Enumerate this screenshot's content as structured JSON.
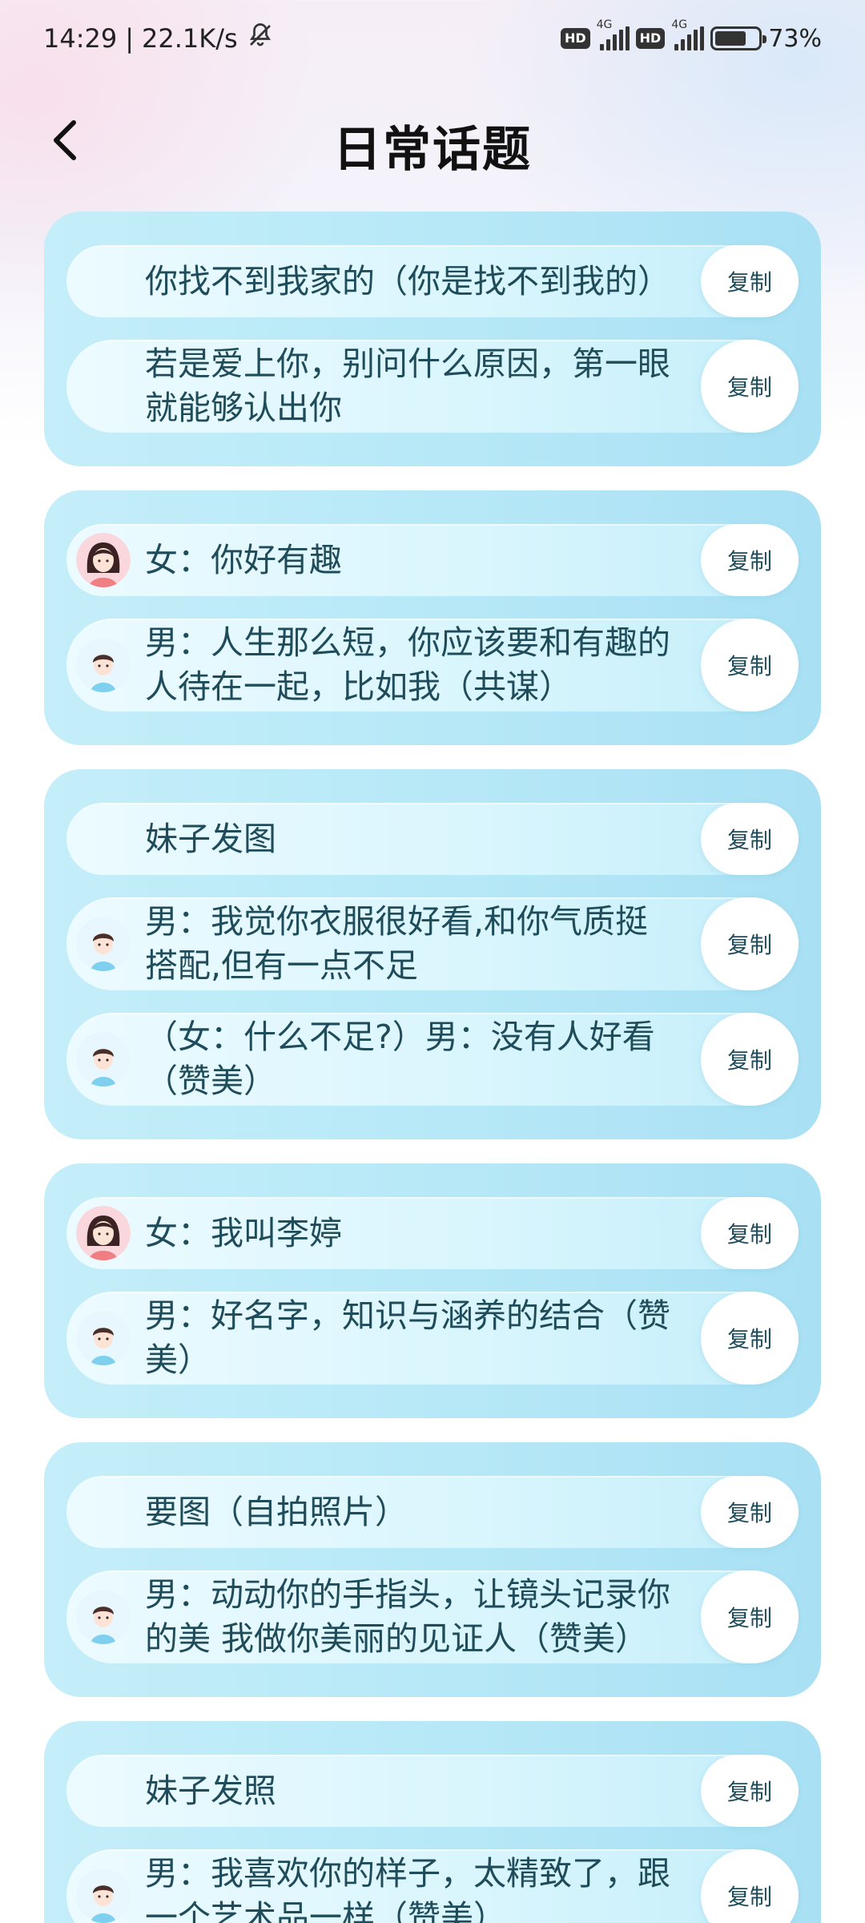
{
  "status_bar": {
    "time": "14:29",
    "speed": "22.1K/s",
    "hd1": "HD",
    "net1": "4G",
    "hd2": "HD",
    "net2": "4G",
    "battery": "73%",
    "battery_level": 0.73,
    "separator": "|",
    "icons": [
      "bell-muted-icon",
      "signal-icon",
      "battery-icon"
    ]
  },
  "header": {
    "title": "日常话题",
    "back_icon": "chevron-left-icon"
  },
  "copy_label": "复制",
  "groups": [
    {
      "rows": [
        {
          "avatar": "none",
          "text": "你找不到我家的（你是找不到我的）",
          "copy": "复制"
        },
        {
          "avatar": "none",
          "text": "若是爱上你，别问什么原因，第一眼就能够认出你",
          "copy": "复制"
        }
      ]
    },
    {
      "rows": [
        {
          "avatar": "female",
          "text": "女：你好有趣",
          "copy": "复制"
        },
        {
          "avatar": "male",
          "text": "男：人生那么短，你应该要和有趣的人待在一起，比如我（共谋）",
          "copy": "复制"
        }
      ]
    },
    {
      "rows": [
        {
          "avatar": "none",
          "text": "妹子发图",
          "copy": "复制"
        },
        {
          "avatar": "male",
          "text": "男：我觉你衣服很好看,和你气质挺搭配,但有一点不足",
          "copy": "复制"
        },
        {
          "avatar": "male",
          "text": "（女：什么不足?）男：没有人好看（赞美）",
          "copy": "复制"
        }
      ]
    },
    {
      "rows": [
        {
          "avatar": "female",
          "text": "女：我叫李婷",
          "copy": "复制"
        },
        {
          "avatar": "male",
          "text": "男：好名字，知识与涵养的结合（赞美）",
          "copy": "复制"
        }
      ]
    },
    {
      "rows": [
        {
          "avatar": "none",
          "text": "要图（自拍照片）",
          "copy": "复制"
        },
        {
          "avatar": "male",
          "text": "男：动动你的手指头，让镜头记录你的美 我做你美丽的见证人（赞美）",
          "copy": "复制"
        }
      ]
    },
    {
      "rows": [
        {
          "avatar": "none",
          "text": "妹子发照",
          "copy": "复制"
        },
        {
          "avatar": "male",
          "text": "男：我喜欢你的样子，太精致了，跟一个艺术品一样（赞美）",
          "copy": "复制"
        }
      ]
    }
  ]
}
